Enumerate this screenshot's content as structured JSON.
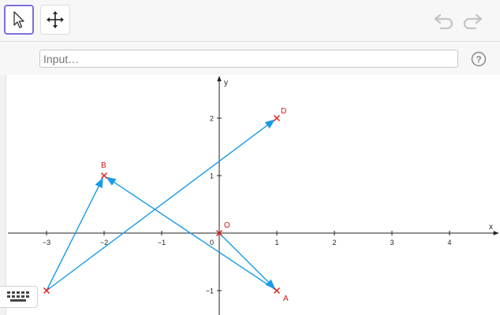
{
  "toolbar": {
    "tools": [
      {
        "name": "move-tool",
        "active": true
      },
      {
        "name": "move-graphics-view-tool",
        "active": false
      }
    ]
  },
  "input": {
    "placeholder": "Input…"
  },
  "graph": {
    "x_axis_label": "x",
    "y_axis_label": "y",
    "x_ticks": [
      -3,
      -2,
      -1,
      1,
      2,
      3,
      4
    ],
    "y_ticks": [
      -1,
      1,
      2
    ],
    "origin_tick": "0",
    "points": [
      {
        "label": "O",
        "x": 0,
        "y": 0
      },
      {
        "label": "A",
        "x": 1,
        "y": -1
      },
      {
        "label": "B",
        "x": -2,
        "y": 1
      },
      {
        "label": "D",
        "x": 1,
        "y": 2
      },
      {
        "label": "",
        "x": -3,
        "y": -1
      }
    ],
    "vectors": [
      {
        "from": [
          -3,
          -1
        ],
        "to": [
          -2,
          1
        ]
      },
      {
        "from": [
          -3,
          -1
        ],
        "to": [
          1,
          2
        ]
      },
      {
        "from": [
          0,
          0
        ],
        "to": [
          1,
          -1
        ]
      },
      {
        "from": [
          1,
          -1
        ],
        "to": [
          -2,
          1
        ]
      }
    ],
    "colors": {
      "vector": "#1a9be6",
      "point": "#e0201c",
      "axis": "#222222",
      "point_label": "#d01010"
    }
  }
}
